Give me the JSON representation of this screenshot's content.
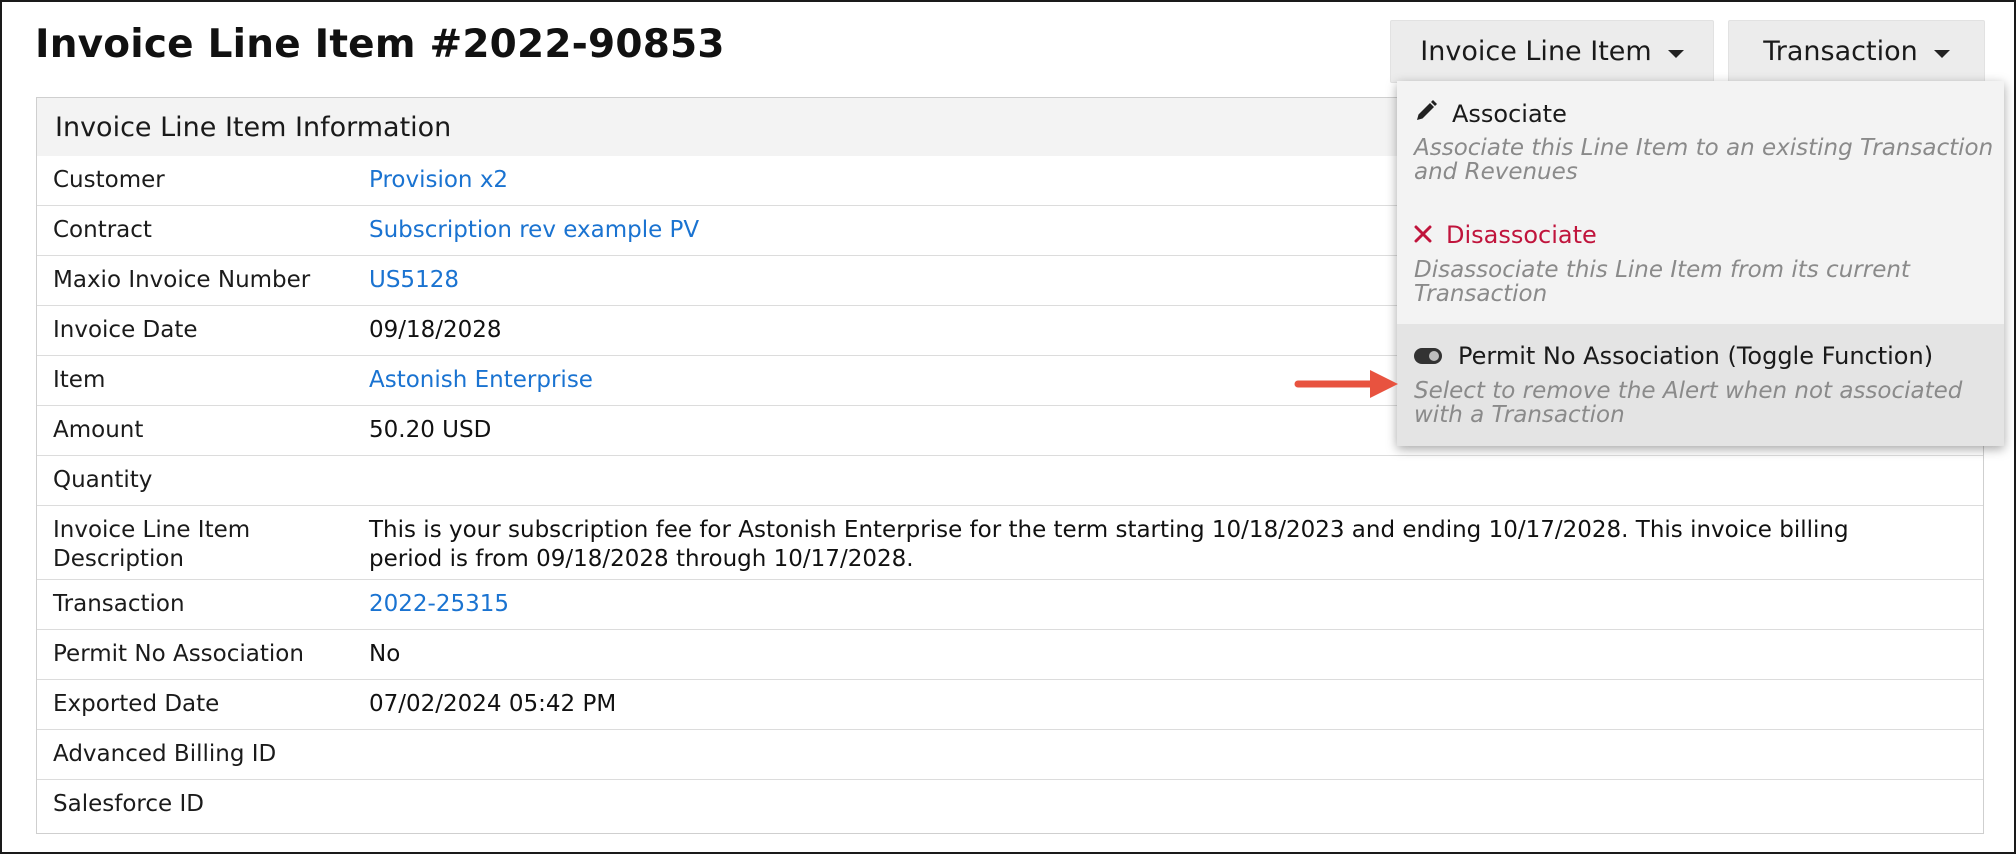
{
  "page": {
    "title": "Invoice Line Item #2022-90853"
  },
  "toolbar": {
    "invoice_line_item_label": "Invoice Line Item",
    "transaction_label": "Transaction"
  },
  "panel": {
    "header": "Invoice Line Item Information",
    "rows": [
      {
        "label": "Customer",
        "value": "Provision x2",
        "link": true
      },
      {
        "label": "Contract",
        "value": "Subscription rev example PV",
        "link": true
      },
      {
        "label": "Maxio Invoice Number",
        "value": "US5128",
        "link": true
      },
      {
        "label": "Invoice Date",
        "value": "09/18/2028",
        "link": false
      },
      {
        "label": "Item",
        "value": "Astonish Enterprise",
        "link": true
      },
      {
        "label": "Amount",
        "value": "50.20 USD",
        "link": false
      },
      {
        "label": "Quantity",
        "value": "",
        "link": false
      },
      {
        "label": "Invoice Line Item Description",
        "value": "This is your subscription fee for Astonish Enterprise for the term starting 10/18/2023 and ending 10/17/2028. This invoice billing period is from 09/18/2028 through 10/17/2028.",
        "link": false
      },
      {
        "label": "Transaction",
        "value": "2022-25315",
        "link": true
      },
      {
        "label": "Permit No Association",
        "value": "No",
        "link": false
      },
      {
        "label": "Exported Date",
        "value": "07/02/2024 05:42 PM",
        "link": false
      },
      {
        "label": "Advanced Billing ID",
        "value": "",
        "link": false
      },
      {
        "label": "Salesforce ID",
        "value": "",
        "link": false
      }
    ]
  },
  "dropdown": {
    "items": [
      {
        "icon": "pencil-icon",
        "title": "Associate",
        "description": "Associate this Line Item to an existing Transaction and Revenues"
      },
      {
        "icon": "x-icon",
        "title": "Disassociate",
        "description": "Disassociate this Line Item from its current Transaction"
      },
      {
        "icon": "toggle-icon",
        "title": "Permit No Association (Toggle Function)",
        "description": "Select to remove the Alert when not associated with a Transaction"
      }
    ]
  },
  "colors": {
    "link": "#1a73d1",
    "danger": "#c0143c",
    "annotation_arrow": "#e8533f",
    "dropdown_bg": "#f3f3f3",
    "highlight_bg": "#e4e4e4"
  }
}
